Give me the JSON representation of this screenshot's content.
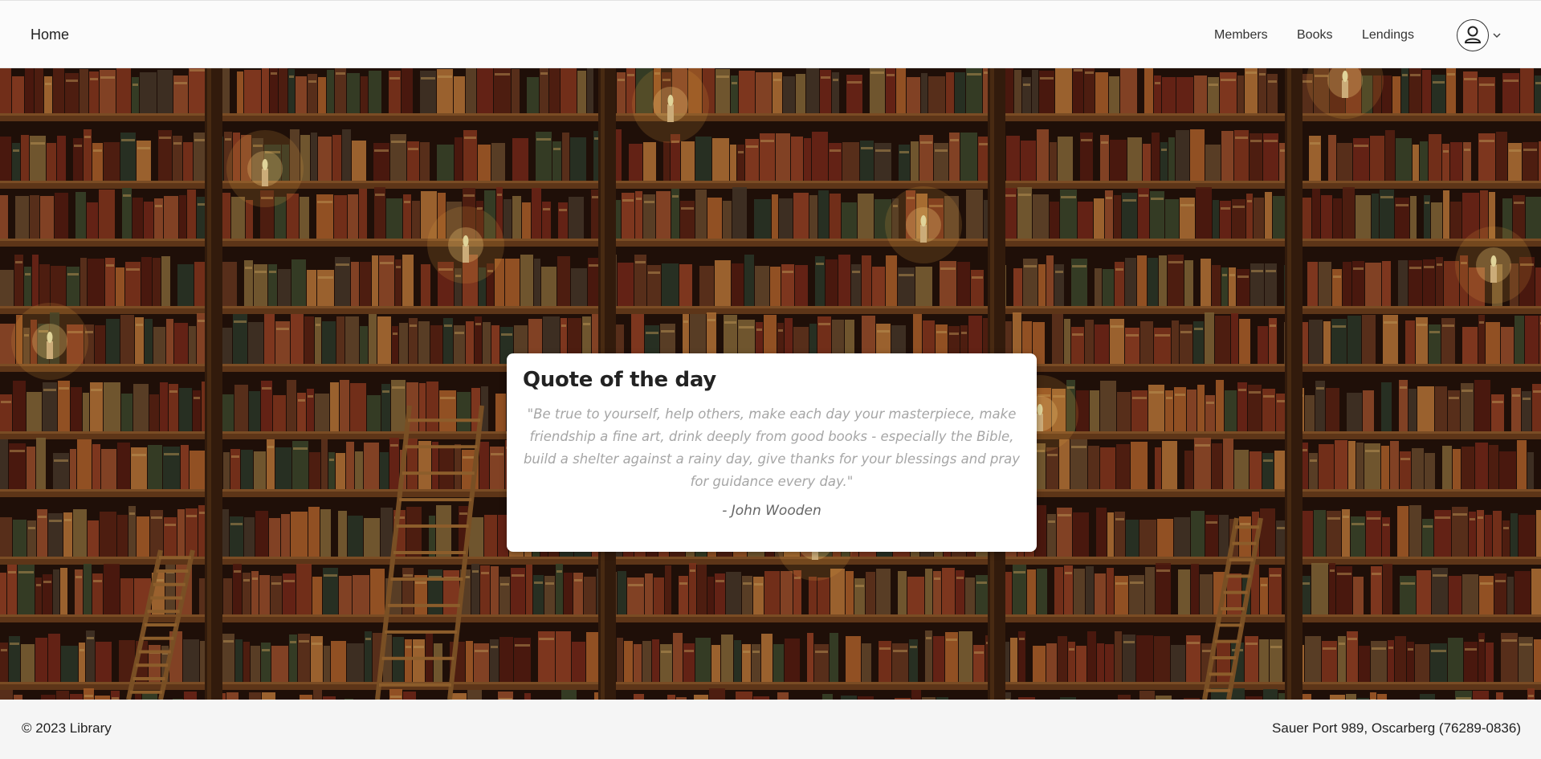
{
  "navbar": {
    "brand": "Home",
    "links": [
      "Members",
      "Books",
      "Lendings"
    ],
    "user_icon": "user-avatar-icon",
    "dropdown_icon": "chevron-down-icon"
  },
  "quote": {
    "title": "Quote of the day",
    "text": "\"Be true to yourself, help others, make each day your masterpiece, make friendship a fine art, drink deeply from good books - especially the Bible, build a shelter against a rainy day, give thanks for your blessings and pray for guidance every day.\"",
    "author": "- John Wooden"
  },
  "footer": {
    "copyright": "© 2023 Library",
    "address": "Sauer Port 989, Oscarberg (76289-0836)"
  },
  "colors": {
    "navbar_bg": "#fbfbfb",
    "footer_bg": "#f5f5f5",
    "shelf_wood": "#5a3418",
    "hero_dark": "#2a1409"
  }
}
